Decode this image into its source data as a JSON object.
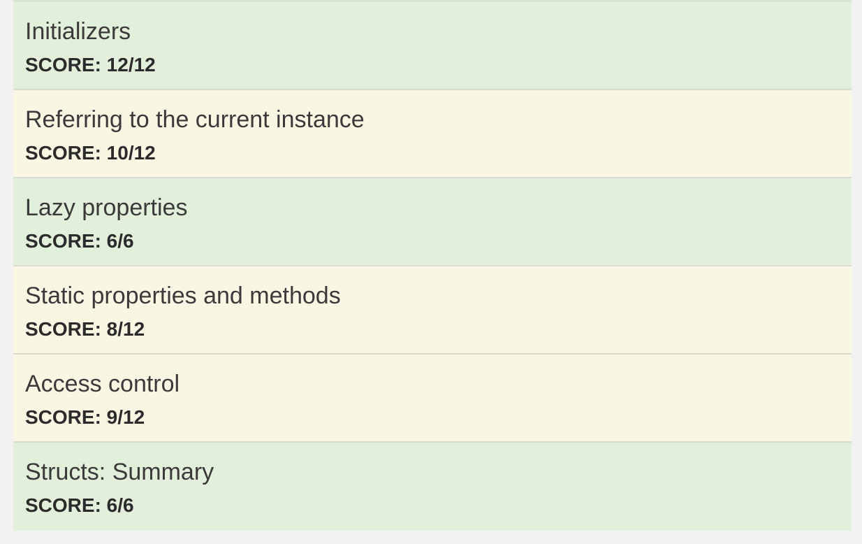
{
  "items": [
    {
      "title": "Initializers",
      "score": "SCORE: 12/12",
      "status": "full"
    },
    {
      "title": "Referring to the current instance",
      "score": "SCORE: 10/12",
      "status": "partial"
    },
    {
      "title": "Lazy properties",
      "score": "SCORE: 6/6",
      "status": "full"
    },
    {
      "title": "Static properties and methods",
      "score": "SCORE: 8/12",
      "status": "partial"
    },
    {
      "title": "Access control",
      "score": "SCORE: 9/12",
      "status": "partial"
    },
    {
      "title": "Structs: Summary",
      "score": "SCORE: 6/6",
      "status": "full"
    }
  ],
  "colors": {
    "full_score_bg": "#e2efda",
    "partial_score_bg": "#f9f7e4"
  }
}
